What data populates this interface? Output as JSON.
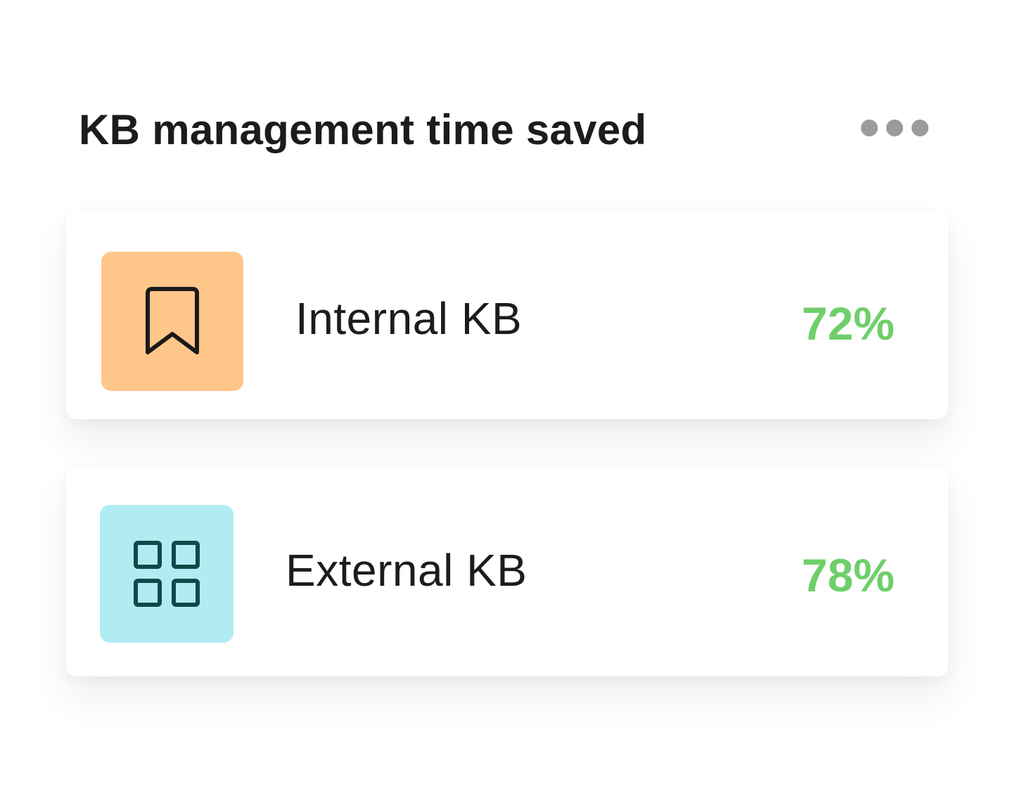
{
  "widget": {
    "title": "KB management time saved",
    "menu_icon": "more-horizontal-icon"
  },
  "colors": {
    "value_green": "#6fcf6a",
    "internal_tile": "#ffc68a",
    "external_tile": "#b1ecf2",
    "bookmark_stroke": "#1a1a1a",
    "grid_stroke": "#0f4a4a"
  },
  "items": [
    {
      "label": "Internal KB",
      "value": "72%",
      "icon": "bookmark-icon"
    },
    {
      "label": "External KB",
      "value": "78%",
      "icon": "grid-icon"
    }
  ]
}
